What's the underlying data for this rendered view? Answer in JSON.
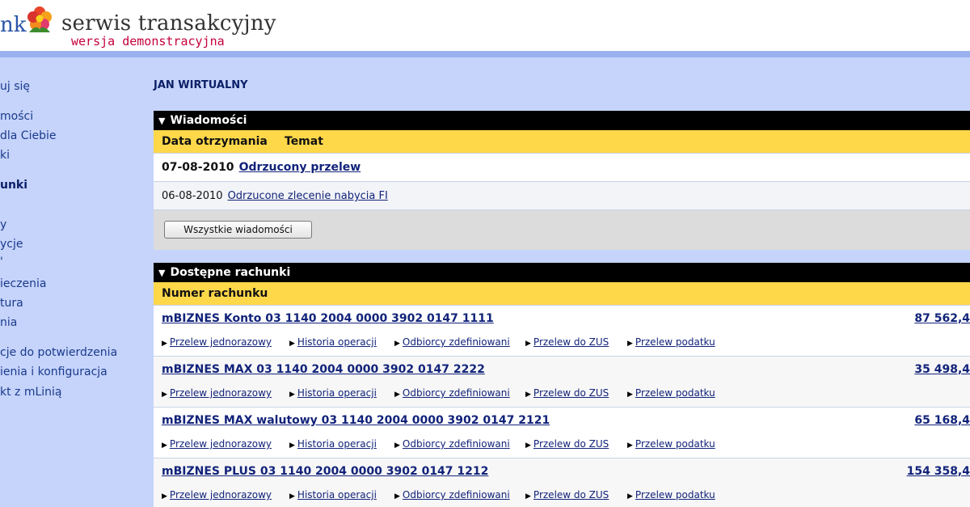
{
  "header": {
    "logo_partial": "nk",
    "title": "serwis transakcyjny",
    "subtitle": "wersja demonstracyjna"
  },
  "sidebar": {
    "items": [
      {
        "label": "uj się",
        "bold": false
      },
      {
        "label": "mości",
        "bold": false
      },
      {
        "label": " dla Ciebie",
        "bold": false
      },
      {
        "label": "ki",
        "bold": false
      },
      {
        "label": "unki",
        "bold": true
      },
      {
        "label": "y",
        "bold": false
      },
      {
        "label": "ycje",
        "bold": false
      },
      {
        "label": "'",
        "bold": false
      },
      {
        "label": "ieczenia",
        "bold": false
      },
      {
        "label": "tura",
        "bold": false
      },
      {
        "label": "nia",
        "bold": false
      },
      {
        "label": "cje do potwierdzenia",
        "bold": false
      },
      {
        "label": "ienia i konfiguracja",
        "bold": false
      },
      {
        "label": "kt z mLinią",
        "bold": false
      }
    ]
  },
  "user": {
    "name": "JAN WIRTUALNY"
  },
  "messages": {
    "title": "Wiadomości",
    "col_date": "Data otrzymania",
    "col_subject": "Temat",
    "rows": [
      {
        "date": "07-08-2010",
        "subject": "Odrzucony przelew"
      },
      {
        "date": "06-08-2010",
        "subject": "Odrzucone zlecenie nabycia FI"
      }
    ],
    "all_button": "Wszystkie wiadomości"
  },
  "accounts": {
    "title": "Dostępne rachunki",
    "col_number": "Numer rachunku",
    "link_labels": [
      "Przelew jednorazowy",
      "Historia operacji",
      "Odbiorcy zdefiniowani",
      "Przelew do ZUS",
      "Przelew podatku"
    ],
    "rows": [
      {
        "name": "mBIZNES Konto 03 1140 2004 0000 3902 0147 1111",
        "balance": "87 562,4"
      },
      {
        "name": "mBIZNES MAX 03 1140 2004 0000 3902 0147 2222",
        "balance": "35 498,4"
      },
      {
        "name": "mBIZNES MAX walutowy 03 1140 2004 0000 3902 0147 2121",
        "balance": "65 168,4"
      },
      {
        "name": "mBIZNES PLUS 03 1140 2004 0000 3902 0147 1212",
        "balance": "154 358,4"
      }
    ]
  }
}
